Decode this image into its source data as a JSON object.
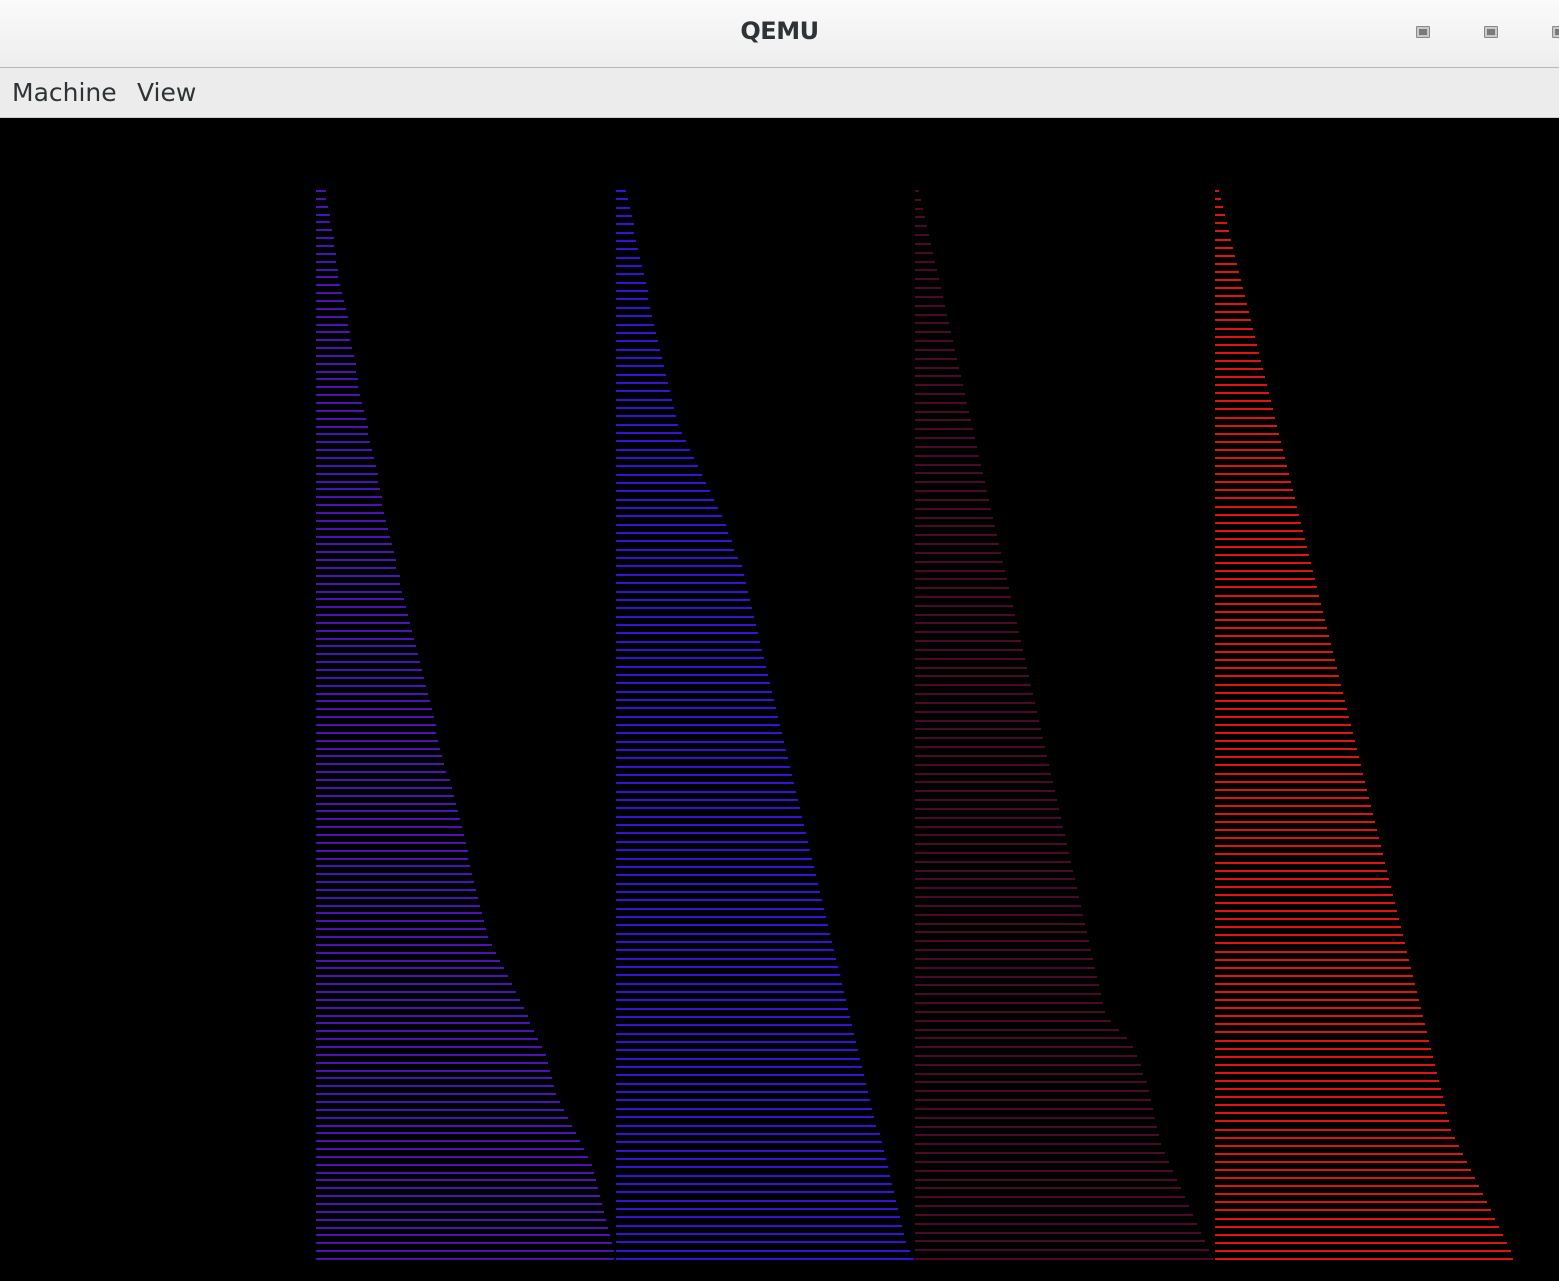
{
  "window": {
    "title": "QEMU"
  },
  "menubar": {
    "items": [
      {
        "label": "Machine"
      },
      {
        "label": "View"
      }
    ]
  },
  "guest_display": {
    "background": "#000000",
    "columns": [
      {
        "color": "#4a13b8",
        "lengths": [
          10,
          10,
          12,
          14,
          14,
          16,
          18,
          18,
          20,
          20,
          22,
          22,
          24,
          26,
          28,
          30,
          32,
          32,
          34,
          34,
          36,
          38,
          40,
          40,
          42,
          42,
          44,
          46,
          48,
          50,
          52,
          52,
          54,
          56,
          58,
          60,
          62,
          62,
          64,
          66,
          66,
          68,
          70,
          72,
          74,
          76,
          78,
          80,
          80,
          84,
          84,
          86,
          88,
          90,
          92,
          94,
          96,
          98,
          100,
          102,
          104,
          106,
          108,
          110,
          112,
          114,
          116,
          118,
          120,
          120,
          122,
          124,
          126,
          128,
          130,
          134,
          136,
          138,
          140,
          142,
          144,
          146,
          148,
          150,
          152,
          152,
          154,
          156,
          158,
          160,
          162,
          164,
          166,
          168,
          170,
          172,
          176,
          180,
          184,
          188,
          192,
          196,
          200,
          204,
          208,
          212,
          214,
          218,
          222,
          226,
          230,
          232,
          234,
          236,
          238,
          240,
          244,
          248,
          252,
          256,
          260,
          264,
          268,
          272,
          276,
          278,
          280,
          282,
          284,
          286,
          288,
          290,
          292,
          294,
          296,
          298,
          298
        ]
      },
      {
        "color": "#3a10d8",
        "lengths": [
          10,
          12,
          14,
          16,
          18,
          18,
          20,
          22,
          24,
          26,
          28,
          30,
          32,
          32,
          34,
          36,
          38,
          40,
          42,
          44,
          46,
          48,
          50,
          52,
          54,
          56,
          58,
          60,
          62,
          66,
          70,
          74,
          78,
          82,
          86,
          90,
          94,
          98,
          102,
          106,
          110,
          112,
          116,
          118,
          122,
          126,
          128,
          130,
          132,
          134,
          136,
          138,
          140,
          142,
          144,
          146,
          148,
          150,
          152,
          154,
          156,
          158,
          160,
          162,
          164,
          166,
          168,
          170,
          172,
          174,
          176,
          178,
          180,
          182,
          184,
          186,
          188,
          190,
          192,
          194,
          196,
          198,
          200,
          202,
          204,
          206,
          208,
          210,
          212,
          214,
          216,
          218,
          220,
          222,
          224,
          226,
          228,
          230,
          232,
          234,
          236,
          238,
          240,
          242,
          244,
          246,
          248,
          250,
          252,
          254,
          256,
          258,
          260,
          264,
          266,
          268,
          270,
          272,
          274,
          276,
          278,
          280,
          282,
          284,
          286,
          288,
          290,
          294,
          298
        ]
      },
      {
        "color": "#4a0a2a",
        "lengths": [
          4,
          6,
          8,
          10,
          12,
          14,
          16,
          18,
          20,
          22,
          24,
          26,
          28,
          30,
          32,
          34,
          36,
          38,
          40,
          42,
          44,
          46,
          48,
          50,
          52,
          54,
          56,
          58,
          60,
          62,
          64,
          66,
          68,
          70,
          72,
          74,
          76,
          78,
          80,
          82,
          84,
          86,
          88,
          90,
          92,
          94,
          96,
          98,
          100,
          102,
          104,
          106,
          108,
          110,
          112,
          114,
          116,
          118,
          120,
          122,
          124,
          126,
          128,
          130,
          132,
          134,
          136,
          138,
          140,
          142,
          144,
          146,
          148,
          150,
          152,
          154,
          156,
          158,
          160,
          162,
          164,
          166,
          168,
          170,
          172,
          174,
          176,
          178,
          180,
          182,
          184,
          186,
          188,
          190,
          196,
          204,
          212,
          218,
          222,
          226,
          228,
          232,
          234,
          236,
          238,
          240,
          242,
          244,
          246,
          250,
          254,
          258,
          262,
          266,
          270,
          274,
          278,
          282,
          286,
          290,
          294,
          298
        ]
      },
      {
        "color": "#e0140e",
        "lengths": [
          4,
          6,
          8,
          10,
          12,
          14,
          16,
          18,
          20,
          22,
          24,
          26,
          28,
          30,
          32,
          34,
          36,
          38,
          40,
          42,
          44,
          46,
          48,
          50,
          52,
          54,
          56,
          58,
          60,
          62,
          64,
          66,
          68,
          70,
          72,
          74,
          76,
          78,
          80,
          82,
          84,
          86,
          88,
          90,
          92,
          94,
          96,
          98,
          100,
          102,
          104,
          106,
          108,
          110,
          112,
          114,
          116,
          118,
          120,
          122,
          124,
          126,
          128,
          130,
          132,
          134,
          136,
          138,
          140,
          142,
          144,
          146,
          148,
          150,
          152,
          154,
          156,
          158,
          160,
          162,
          164,
          166,
          168,
          170,
          172,
          174,
          176,
          178,
          180,
          182,
          184,
          186,
          188,
          190,
          192,
          194,
          196,
          198,
          200,
          202,
          204,
          206,
          208,
          210,
          212,
          214,
          216,
          218,
          220,
          222,
          224,
          226,
          228,
          230,
          232,
          234,
          236,
          240,
          244,
          248,
          252,
          256,
          260,
          264,
          268,
          272,
          276,
          280,
          284,
          288,
          292,
          296,
          298
        ]
      }
    ]
  }
}
